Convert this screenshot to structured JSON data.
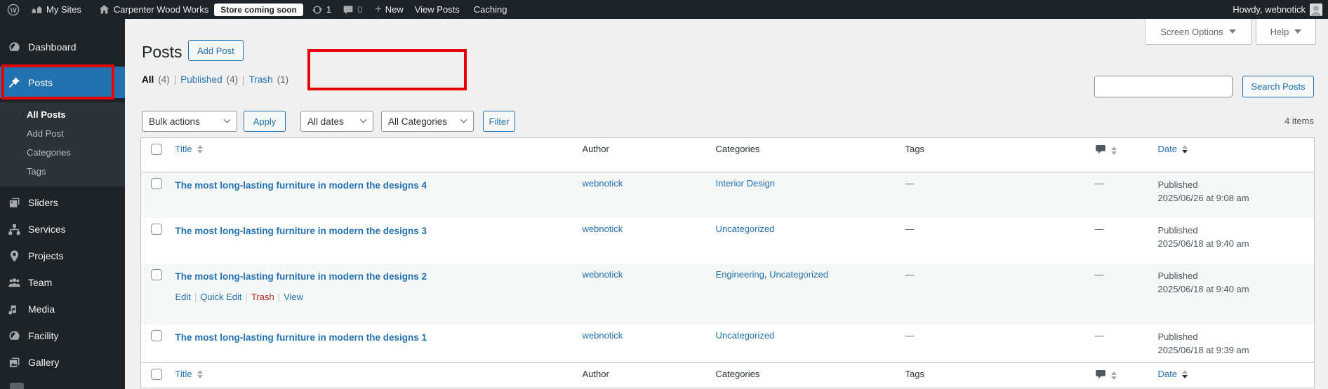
{
  "admin_bar": {
    "my_sites": "My Sites",
    "site_name": "Carpenter Wood Works",
    "store_badge": "Store coming soon",
    "update_count": "1",
    "comment_count": "0",
    "plus": "+",
    "new_label": "New",
    "view_posts": "View Posts",
    "caching": "Caching",
    "howdy": "Howdy, webnotick"
  },
  "sidebar": {
    "dashboard": "Dashboard",
    "posts": "Posts",
    "submenu": {
      "all_posts": "All Posts",
      "add_post": "Add Post",
      "categories": "Categories",
      "tags": "Tags"
    },
    "sliders": "Sliders",
    "services": "Services",
    "projects": "Projects",
    "team": "Team",
    "media": "Media",
    "facility": "Facility",
    "gallery": "Gallery"
  },
  "page": {
    "title": "Posts",
    "add_post_button": "Add Post",
    "screen_options": "Screen Options",
    "help": "Help",
    "search_button": "Search Posts",
    "items_count": "4 items",
    "views": {
      "all": "All",
      "all_count": "(4)",
      "published": "Published",
      "published_count": "(4)",
      "trash": "Trash",
      "trash_count": "(1)"
    }
  },
  "filters": {
    "bulk_actions": "Bulk actions",
    "apply": "Apply",
    "all_dates": "All dates",
    "all_categories": "All Categories",
    "filter": "Filter"
  },
  "table": {
    "headers": {
      "title": "Title",
      "author": "Author",
      "categories": "Categories",
      "tags": "Tags",
      "date": "Date"
    },
    "rows": [
      {
        "title": "The most long-lasting furniture in modern the designs 4",
        "author": "webnotick",
        "categories": [
          "Interior Design"
        ],
        "tags": "—",
        "comments": "—",
        "status": "Published",
        "date": "2025/06/26 at 9:08 am"
      },
      {
        "title": "The most long-lasting furniture in modern the designs 3",
        "author": "webnotick",
        "categories": [
          "Uncategorized"
        ],
        "tags": "—",
        "comments": "—",
        "status": "Published",
        "date": "2025/06/18 at 9:40 am"
      },
      {
        "title": "The most long-lasting furniture in modern the designs 2",
        "author": "webnotick",
        "categories": [
          "Engineering",
          "Uncategorized"
        ],
        "tags": "—",
        "comments": "—",
        "status": "Published",
        "date": "2025/06/18 at 9:40 am"
      },
      {
        "title": "The most long-lasting furniture in modern the designs 1",
        "author": "webnotick",
        "categories": [
          "Uncategorized"
        ],
        "tags": "—",
        "comments": "—",
        "status": "Published",
        "date": "2025/06/18 at 9:39 am"
      }
    ],
    "row_actions": {
      "edit": "Edit",
      "quick_edit": "Quick Edit",
      "trash": "Trash",
      "view": "View"
    }
  },
  "punctuation": {
    "pipe": "|",
    "comma": ", "
  },
  "colors": {
    "accent": "#2271b1",
    "annotation_red": "#e60000",
    "trash_red": "#b32d2e",
    "admin_bg": "#1d2327",
    "content_bg": "#f0f0f1",
    "stripe": "#f6f7f7"
  }
}
